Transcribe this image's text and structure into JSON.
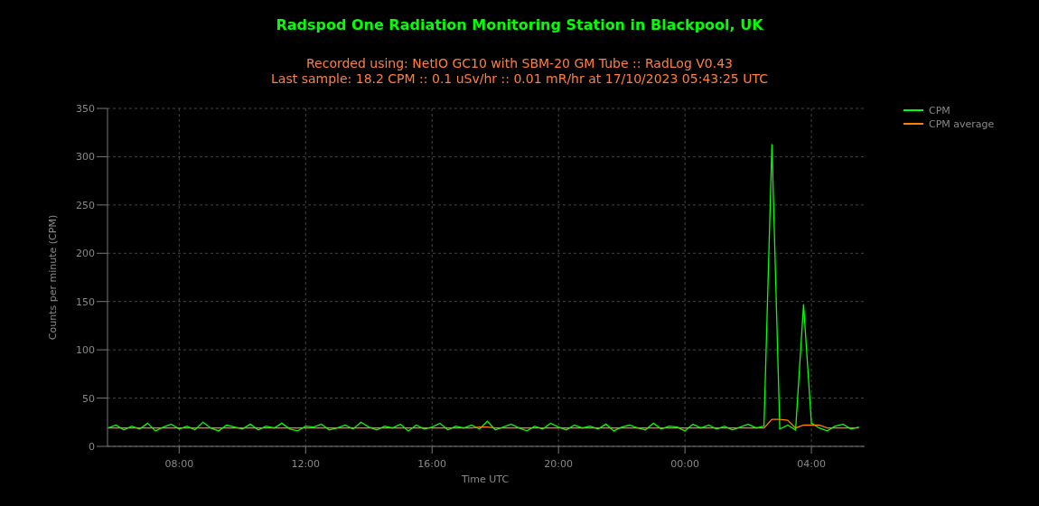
{
  "title": "Radspod One Radiation Monitoring Station in Blackpool, UK",
  "subtitle_lines": [
    "Recorded using: NetIO GC10 with SBM-20 GM Tube :: RadLog V0.43",
    "Last sample: 18.2 CPM :: 0.1 uSv/hr :: 0.01 mR/hr at 17/10/2023 05:43:25 UTC"
  ],
  "chart": {
    "chart_data": {
      "type": "line",
      "xlabel": "Time UTC",
      "ylabel": "Counts per minute (CPM)",
      "x": [
        "2023-10-16 05:45",
        "2023-10-16 06:00",
        "2023-10-16 06:15",
        "2023-10-16 06:30",
        "2023-10-16 06:45",
        "2023-10-16 07:00",
        "2023-10-16 07:15",
        "2023-10-16 07:30",
        "2023-10-16 07:45",
        "2023-10-16 08:00",
        "2023-10-16 08:15",
        "2023-10-16 08:30",
        "2023-10-16 08:45",
        "2023-10-16 09:00",
        "2023-10-16 09:15",
        "2023-10-16 09:30",
        "2023-10-16 09:45",
        "2023-10-16 10:00",
        "2023-10-16 10:15",
        "2023-10-16 10:30",
        "2023-10-16 10:45",
        "2023-10-16 11:00",
        "2023-10-16 11:15",
        "2023-10-16 11:30",
        "2023-10-16 11:45",
        "2023-10-16 12:00",
        "2023-10-16 12:15",
        "2023-10-16 12:30",
        "2023-10-16 12:45",
        "2023-10-16 13:00",
        "2023-10-16 13:15",
        "2023-10-16 13:30",
        "2023-10-16 13:45",
        "2023-10-16 14:00",
        "2023-10-16 14:15",
        "2023-10-16 14:30",
        "2023-10-16 14:45",
        "2023-10-16 15:00",
        "2023-10-16 15:15",
        "2023-10-16 15:30",
        "2023-10-16 15:45",
        "2023-10-16 16:00",
        "2023-10-16 16:15",
        "2023-10-16 16:30",
        "2023-10-16 16:45",
        "2023-10-16 17:00",
        "2023-10-16 17:15",
        "2023-10-16 17:30",
        "2023-10-16 17:45",
        "2023-10-16 18:00",
        "2023-10-16 18:15",
        "2023-10-16 18:30",
        "2023-10-16 18:45",
        "2023-10-16 19:00",
        "2023-10-16 19:15",
        "2023-10-16 19:30",
        "2023-10-16 19:45",
        "2023-10-16 20:00",
        "2023-10-16 20:15",
        "2023-10-16 20:30",
        "2023-10-16 20:45",
        "2023-10-16 21:00",
        "2023-10-16 21:15",
        "2023-10-16 21:30",
        "2023-10-16 21:45",
        "2023-10-16 22:00",
        "2023-10-16 22:15",
        "2023-10-16 22:30",
        "2023-10-16 22:45",
        "2023-10-16 23:00",
        "2023-10-16 23:15",
        "2023-10-16 23:30",
        "2023-10-16 23:45",
        "2023-10-17 00:00",
        "2023-10-17 00:15",
        "2023-10-17 00:30",
        "2023-10-17 00:45",
        "2023-10-17 01:00",
        "2023-10-17 01:15",
        "2023-10-17 01:30",
        "2023-10-17 01:45",
        "2023-10-17 02:00",
        "2023-10-17 02:15",
        "2023-10-17 02:30",
        "2023-10-17 02:45",
        "2023-10-17 03:00",
        "2023-10-17 03:15",
        "2023-10-17 03:30",
        "2023-10-17 03:45",
        "2023-10-17 04:00",
        "2023-10-17 04:15",
        "2023-10-17 04:30",
        "2023-10-17 04:45",
        "2023-10-17 05:00",
        "2023-10-17 05:15",
        "2023-10-17 05:30"
      ],
      "series": [
        {
          "name": "CPM",
          "color": "#00ff00",
          "values": [
            19,
            22,
            17,
            21,
            18,
            24,
            16,
            20,
            23,
            18,
            21,
            17,
            25,
            19,
            16,
            22,
            20,
            18,
            23,
            17,
            21,
            19,
            24,
            18,
            16,
            21,
            20,
            23,
            17,
            19,
            22,
            18,
            25,
            20,
            17,
            21,
            19,
            23,
            16,
            22,
            18,
            20,
            24,
            17,
            21,
            19,
            22,
            18,
            26,
            17,
            20,
            23,
            19,
            16,
            21,
            18,
            24,
            20,
            17,
            22,
            19,
            21,
            18,
            23,
            16,
            20,
            22,
            19,
            17,
            24,
            18,
            21,
            20,
            16,
            23,
            19,
            22,
            18,
            21,
            17,
            20,
            23,
            19,
            21,
            313,
            18,
            22,
            17,
            147,
            24,
            19,
            16,
            21,
            23,
            18,
            20
          ]
        },
        {
          "name": "CPM average",
          "color": "#ff8000",
          "values": [
            19,
            19,
            19,
            19,
            19,
            19,
            19,
            19,
            19,
            19,
            19,
            19,
            19,
            19,
            19,
            19,
            19,
            19,
            19,
            19,
            19,
            19,
            19,
            19,
            19,
            19,
            19,
            19,
            19,
            19,
            19,
            19,
            19,
            19,
            19,
            19,
            19,
            19,
            19,
            19,
            19,
            19,
            19,
            19,
            19,
            19,
            19,
            20,
            20,
            19,
            19,
            19,
            19,
            19,
            19,
            19,
            19,
            19,
            19,
            19,
            19,
            19,
            19,
            19,
            19,
            19,
            19,
            19,
            19,
            19,
            19,
            19,
            19,
            19,
            19,
            19,
            19,
            19,
            19,
            19,
            19,
            19,
            19,
            19,
            28,
            28,
            27,
            19,
            22,
            22,
            22,
            19,
            19,
            19,
            19,
            19
          ]
        }
      ],
      "xlim": [
        "2023-10-16 05:44",
        "2023-10-17 05:41"
      ],
      "ylim": [
        0,
        350
      ],
      "xticks": [
        {
          "value": "2023-10-16 08:00",
          "label": "08:00"
        },
        {
          "value": "2023-10-16 12:00",
          "label": "12:00"
        },
        {
          "value": "2023-10-16 16:00",
          "label": "16:00"
        },
        {
          "value": "2023-10-16 20:00",
          "label": "20:00"
        },
        {
          "value": "2023-10-17 00:00",
          "label": "00:00"
        },
        {
          "value": "2023-10-17 04:00",
          "label": "04:00"
        }
      ],
      "yticks": [
        0,
        50,
        100,
        150,
        200,
        250,
        300,
        350
      ],
      "grid": true,
      "legend": true
    }
  }
}
